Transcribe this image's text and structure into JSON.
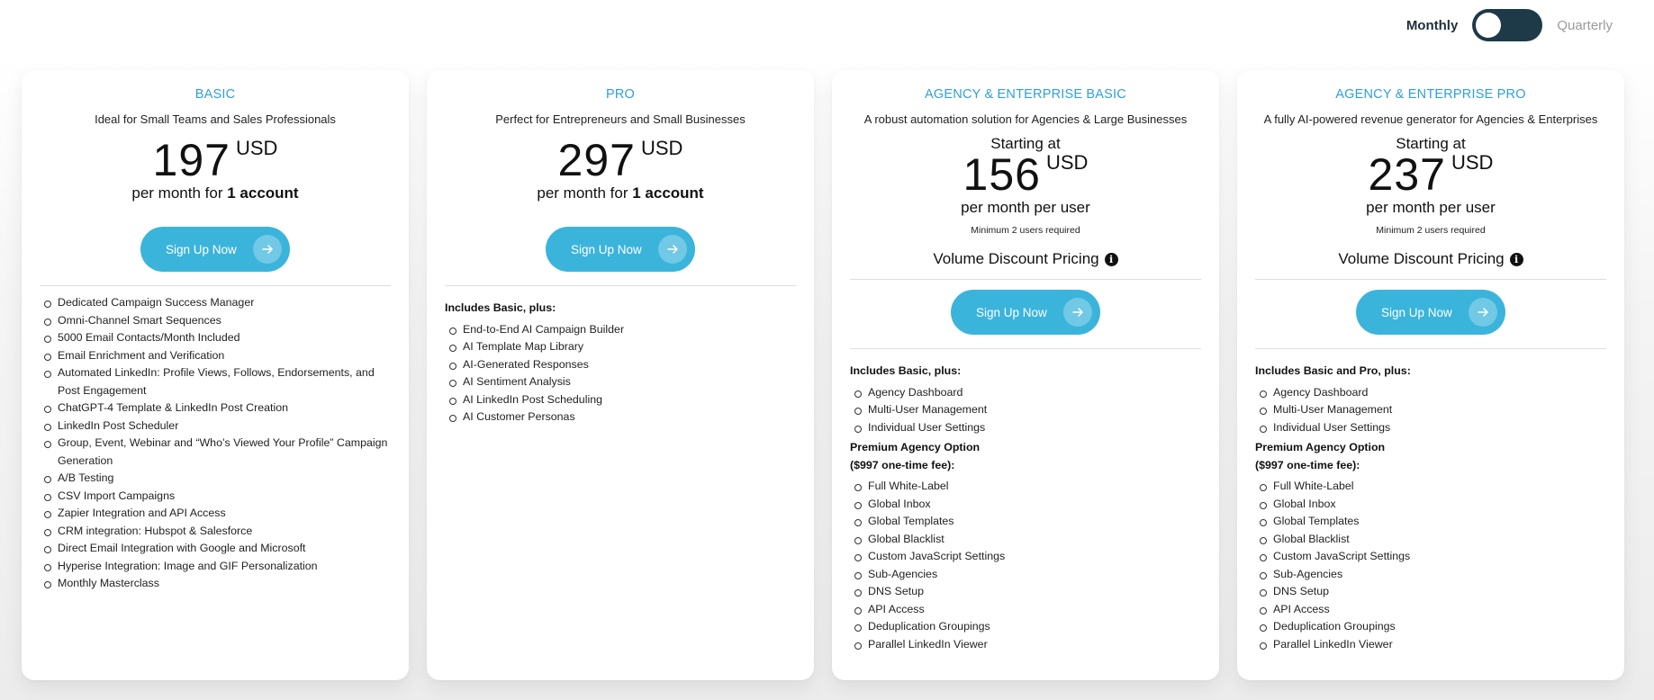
{
  "toggle": {
    "monthly_label": "Monthly",
    "quarterly_label": "Quarterly",
    "selected": "Monthly"
  },
  "colors": {
    "accent": "#2fa0d8",
    "button": "#3bb4dc",
    "toggle": "#1e3a48"
  },
  "plans": [
    {
      "title": "BASIC",
      "subtitle": "Ideal for Small Teams and Sales Professionals",
      "price": "197",
      "currency": "USD",
      "period_prefix": "per month for",
      "period_bold": "1 account",
      "button": "Sign Up Now",
      "features": [
        "Dedicated Campaign Success Manager",
        "Omni-Channel Smart Sequences",
        "5000 Email Contacts/Month Included",
        "Email Enrichment and Verification",
        "Automated LinkedIn: Profile Views, Follows, Endorsements, and Post Engagement",
        "ChatGPT-4 Template & LinkedIn Post Creation",
        "LinkedIn Post Scheduler",
        "Group, Event, Webinar and “Who’s Viewed Your Profile” Campaign Generation",
        "A/B Testing",
        "CSV Import Campaigns",
        "Zapier Integration and API Access",
        "CRM integration: Hubspot & Salesforce",
        "Direct Email Integration with Google and Microsoft",
        "Hyperise Integration: Image and GIF Personalization",
        "Monthly Masterclass"
      ]
    },
    {
      "title": "PRO",
      "subtitle": "Perfect for Entrepreneurs and Small Businesses",
      "price": "297",
      "currency": "USD",
      "period_prefix": "per month for",
      "period_bold": "1 account",
      "button": "Sign Up Now",
      "includes_heading": "Includes Basic, plus:",
      "features": [
        "End-to-End AI Campaign Builder",
        "AI Template Map Library",
        "AI-Generated Responses",
        "AI Sentiment Analysis",
        "AI LinkedIn Post Scheduling",
        "AI Customer Personas"
      ]
    },
    {
      "title": "AGENCY & ENTERPRISE BASIC",
      "subtitle": "A robust automation solution for Agencies & Large Businesses",
      "starting": "Starting at",
      "price": "156",
      "currency": "USD",
      "period": "per month per user",
      "min_users": "Minimum 2 users required",
      "volume": "Volume Discount Pricing",
      "button": "Sign Up Now",
      "includes_heading": "Includes Basic, plus:",
      "features": [
        "Agency Dashboard",
        "Multi-User Management",
        "Individual User Settings"
      ],
      "premium_heading_1": "Premium Agency Option",
      "premium_heading_2": "($997 one-time fee):",
      "premium_features": [
        "Full White-Label",
        "Global Inbox",
        "Global Templates",
        "Global Blacklist",
        "Custom JavaScript Settings",
        "Sub-Agencies",
        "DNS Setup",
        "API Access",
        "Deduplication Groupings",
        "Parallel LinkedIn Viewer"
      ]
    },
    {
      "title": "AGENCY & ENTERPRISE PRO",
      "subtitle": "A fully AI-powered revenue generator for Agencies & Enterprises",
      "starting": "Starting at",
      "price": "237",
      "currency": "USD",
      "period": "per month per user",
      "min_users": "Minimum 2 users required",
      "volume": "Volume Discount Pricing",
      "button": "Sign Up Now",
      "includes_heading": "Includes Basic and Pro, plus:",
      "features": [
        "Agency Dashboard",
        "Multi-User Management",
        "Individual User Settings"
      ],
      "premium_heading_1": "Premium Agency Option",
      "premium_heading_2": "($997 one-time fee):",
      "premium_features": [
        "Full White-Label",
        "Global Inbox",
        "Global Templates",
        "Global Blacklist",
        "Custom JavaScript Settings",
        "Sub-Agencies",
        "DNS Setup",
        "API Access",
        "Deduplication Groupings",
        "Parallel LinkedIn Viewer"
      ]
    }
  ]
}
